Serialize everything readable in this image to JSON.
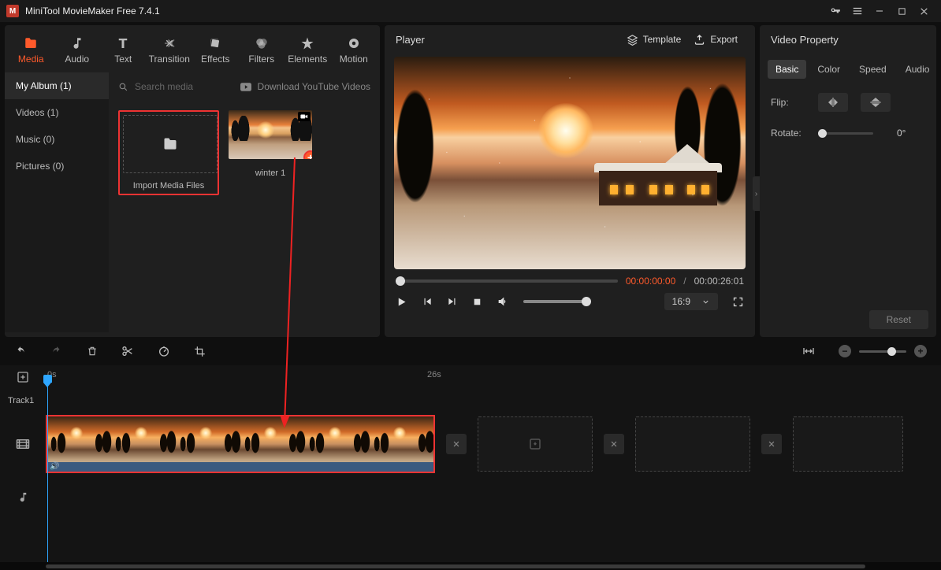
{
  "window": {
    "title": "MiniTool MovieMaker Free 7.4.1"
  },
  "main_tabs": {
    "media": "Media",
    "audio": "Audio",
    "text": "Text",
    "transition": "Transition",
    "effects": "Effects",
    "filters": "Filters",
    "elements": "Elements",
    "motion": "Motion"
  },
  "sidebar": {
    "my_album": "My Album (1)",
    "videos": "Videos (1)",
    "music": "Music (0)",
    "pictures": "Pictures (0)"
  },
  "media": {
    "search_placeholder": "Search media",
    "download_yt": "Download YouTube Videos",
    "import_label": "Import Media Files",
    "clip1_name": "winter 1"
  },
  "player": {
    "title": "Player",
    "template": "Template",
    "export": "Export",
    "time_current": "00:00:00:00",
    "time_sep": " / ",
    "time_duration": "00:00:26:01",
    "aspect": "16:9"
  },
  "props": {
    "title": "Video Property",
    "tabs": {
      "basic": "Basic",
      "color": "Color",
      "speed": "Speed",
      "audio": "Audio"
    },
    "flip_label": "Flip:",
    "rotate_label": "Rotate:",
    "rotate_value": "0°",
    "reset": "Reset"
  },
  "timeline": {
    "tick0": "0s",
    "tick26": "26s",
    "track1": "Track1"
  }
}
